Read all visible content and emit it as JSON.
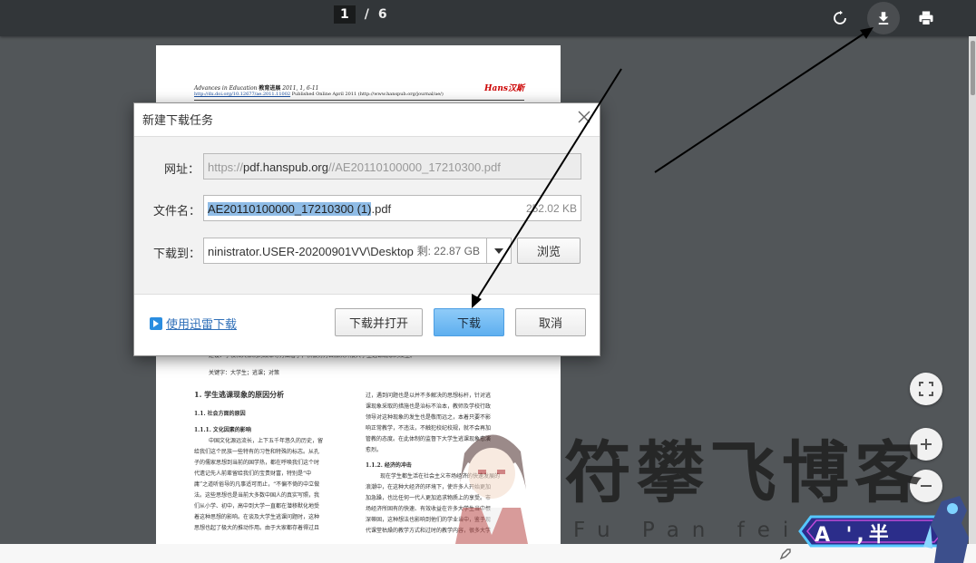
{
  "toolbar": {
    "current_page": "1",
    "separator": "/",
    "total_pages": "6",
    "rotate_icon": "rotate-icon",
    "download_icon": "download-icon",
    "print_icon": "print-icon"
  },
  "document": {
    "journal_title": "Advances in Education",
    "journal_cn": "教育进展",
    "journal_issue": "2011, 1, 6-11",
    "doi_link": "http://dx.doi.org/10.12677/ae.2011.11002",
    "published": "Published Online April 2011 (http://www.hanspub.org/journal/ae/)",
    "publisher_logo": "Hans汉斯",
    "visible_lines": [
      "建设、学校和天体制的改革等方面着手，积极努力去解决开展大学生逃课现象的发生。",
      "关键字：大学生；逃课；对策",
      "1. 学生逃课现象的原因分析",
      "1.1. 社会方面的原因",
      "1.1.1. 文化因素的影响",
      "中国文化源远流长，上下五千年悠久的历史，留",
      "给我们这个民族一些特有的习性和特殊的标志。从孔",
      "子的儒家思想到当前的国学热，都在呼唤我们这个时",
      "代遗记先人前辈留给我们的宝贵财富，特别是“中",
      "庸”之道听俗导的凡事适可而止，“不偏不倚的中立做",
      "法。这些思想也是当前大多数中国人的真实写照，我",
      "们从小学、初中，高中到大学一直都在潜移默化地受",
      "着这种思想的影响。在谈及大学生逃课问题时，这种",
      "思想也起了极大的推动作用。由于大家都存着得过且",
      "过，遇到问题也是以并不多解决的思想标杆，针对逃",
      "课现象采取的措施也是治标不治本，教师及学校行政",
      "领导对这种现象的发生也是敬而远之，本着只要不影",
      "响正常教学，不违法，不触犯校纪校规，就不会再加",
      "管教的态度。在此体制的监督下大学生逃课现象愈演",
      "愈烈。",
      "1.1.2. 经济的冲击",
      "现在学生都生活在社会主义市场经济的快速发展的",
      "浪潮中，在这种大经济的环境下，使许多人开始更加",
      "加急躁，也比任何一代人更加追求物质上的享受。市",
      "场经济所固有的快速、有效收益在许多大学生当中根",
      "深蒂固，这种想法也影响到他们的学业当中，鉴于现",
      "代课堂枯燥的教学方式和过时的教学内容，很多大学"
    ]
  },
  "dialog": {
    "title": "新建下载任务",
    "url_label": "网址：",
    "url_prefix": "https://",
    "url_domain": "pdf.hanspub.org",
    "url_path": "//AE20110100000_17210300.pdf",
    "filename_label": "文件名：",
    "filename_selected": "AE20110100000_17210300 (1)",
    "filename_ext": ".pdf",
    "file_size": "252.02 KB",
    "saveto_label": "下载到：",
    "save_path": "ninistrator.USER-20200901VV\\Desktop",
    "free_space": "剩: 22.87 GB",
    "browse_label": "浏览",
    "xunlei_link": "使用迅雷下载",
    "download_open_label": "下载并打开",
    "download_label": "下载",
    "cancel_label": "取消"
  },
  "watermark": {
    "main_text": "符攀飞博客",
    "sub_text": "Fu Pan fei",
    "badge_text": "A ',半 "
  },
  "colors": {
    "viewer_bg": "#525659",
    "toolbar_bg": "#323639",
    "primary_button": "#5eafef",
    "selection": "#8fbce6",
    "annotation_arrow": "#000000"
  }
}
